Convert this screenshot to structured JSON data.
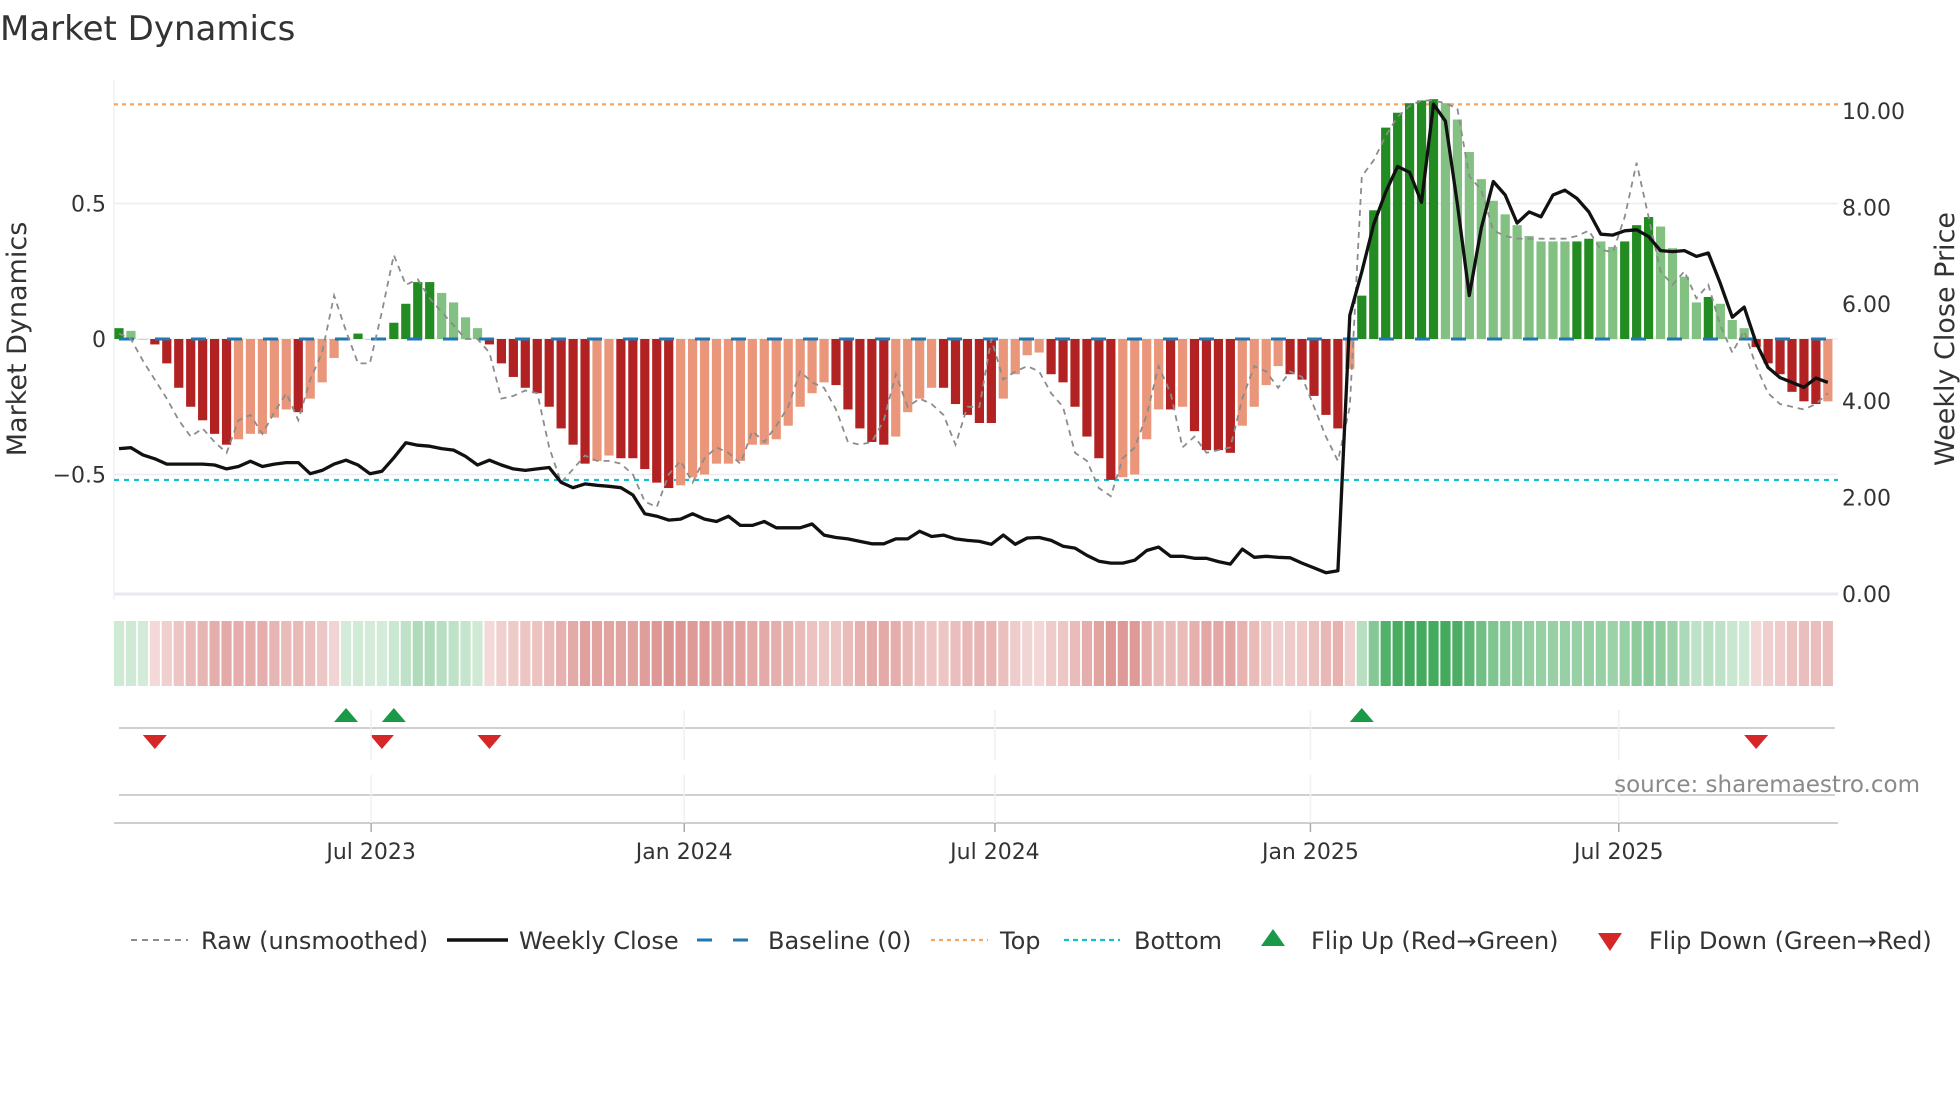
{
  "chart_data": {
    "type": "bar",
    "title": "Market Dynamics",
    "ylabel": "Market Dynamics",
    "ylabel_right": "Weekly Close Price",
    "ylim": [
      -0.92,
      0.95
    ],
    "ylim_right": [
      0,
      10.6
    ],
    "yticks": [
      {
        "value": 0.5,
        "label": "0.5"
      },
      {
        "value": 0,
        "label": "0"
      },
      {
        "value": -0.5,
        "label": "−0.5"
      }
    ],
    "yticks_right": [
      {
        "value": 10,
        "label": "10.00"
      },
      {
        "value": 8,
        "label": "8.00"
      },
      {
        "value": 6,
        "label": "6.00"
      },
      {
        "value": 4,
        "label": "4.00"
      },
      {
        "value": 2,
        "label": "2.00"
      },
      {
        "value": 0,
        "label": "0.00"
      }
    ],
    "xticks": [
      {
        "week": 21.1,
        "label": "Jul 2023"
      },
      {
        "week": 47.3,
        "label": "Jan 2024"
      },
      {
        "week": 73.3,
        "label": "Jul 2024"
      },
      {
        "week": 99.7,
        "label": "Jan 2025"
      },
      {
        "week": 125.5,
        "label": "Jul 2025"
      }
    ],
    "top_level": 0.866,
    "bottom_level": -0.52,
    "baseline": 0,
    "colors": {
      "pos_strong": "#228b22",
      "pos_weak": "#82c182",
      "neg_strong": "#b22222",
      "neg_weak": "#e9967a",
      "close": "#111111",
      "raw": "#8c8c8c",
      "baseline": "#1f77b4",
      "top": "#f4a460",
      "bottom": "#17becf",
      "flip_up": "#1a9a48",
      "flip_down": "#d62728"
    },
    "bars": [
      0.04,
      0.03,
      0,
      -0.02,
      -0.09,
      -0.18,
      -0.25,
      -0.3,
      -0.35,
      -0.39,
      -0.37,
      -0.35,
      -0.35,
      -0.29,
      -0.26,
      -0.27,
      -0.22,
      -0.16,
      -0.07,
      0,
      0.02,
      0,
      0,
      0.06,
      0.13,
      0.21,
      0.21,
      0.17,
      0.135,
      0.08,
      0.04,
      -0.02,
      -0.09,
      -0.14,
      -0.18,
      -0.2,
      -0.25,
      -0.33,
      -0.39,
      -0.46,
      -0.45,
      -0.43,
      -0.44,
      -0.44,
      -0.48,
      -0.53,
      -0.55,
      -0.54,
      -0.51,
      -0.5,
      -0.46,
      -0.46,
      -0.45,
      -0.39,
      -0.39,
      -0.37,
      -0.32,
      -0.25,
      -0.2,
      -0.16,
      -0.17,
      -0.26,
      -0.33,
      -0.38,
      -0.39,
      -0.36,
      -0.27,
      -0.22,
      -0.18,
      -0.18,
      -0.24,
      -0.28,
      -0.31,
      -0.31,
      -0.22,
      -0.13,
      -0.06,
      -0.05,
      -0.13,
      -0.16,
      -0.25,
      -0.36,
      -0.44,
      -0.52,
      -0.51,
      -0.5,
      -0.37,
      -0.26,
      -0.26,
      -0.25,
      -0.34,
      -0.41,
      -0.41,
      -0.42,
      -0.32,
      -0.25,
      -0.17,
      -0.1,
      -0.13,
      -0.15,
      -0.21,
      -0.28,
      -0.33,
      -0.11,
      0.16,
      0.475,
      0.78,
      0.835,
      0.87,
      0.88,
      0.885,
      0.87,
      0.81,
      0.69,
      0.59,
      0.51,
      0.46,
      0.42,
      0.38,
      0.36,
      0.36,
      0.36,
      0.36,
      0.37,
      0.36,
      0.34,
      0.36,
      0.42,
      0.45,
      0.415,
      0.335,
      0.23,
      0.135,
      0.155,
      0.13,
      0.07,
      0.04,
      -0.03,
      -0.09,
      -0.13,
      -0.195,
      -0.23,
      -0.24,
      -0.23
    ],
    "shade": [
      "D",
      "L",
      "L",
      "D",
      "D",
      "D",
      "D",
      "D",
      "D",
      "D",
      "L",
      "L",
      "L",
      "L",
      "L",
      "D",
      "L",
      "L",
      "L",
      "L",
      "D",
      "L",
      "L",
      "D",
      "D",
      "D",
      "D",
      "L",
      "L",
      "L",
      "L",
      "D",
      "D",
      "D",
      "D",
      "D",
      "D",
      "D",
      "D",
      "D",
      "L",
      "L",
      "D",
      "D",
      "D",
      "D",
      "D",
      "L",
      "L",
      "L",
      "L",
      "L",
      "L",
      "L",
      "L",
      "L",
      "L",
      "L",
      "L",
      "L",
      "D",
      "D",
      "D",
      "D",
      "D",
      "L",
      "L",
      "L",
      "L",
      "D",
      "D",
      "D",
      "D",
      "D",
      "L",
      "L",
      "L",
      "L",
      "D",
      "D",
      "D",
      "D",
      "D",
      "D",
      "L",
      "L",
      "L",
      "L",
      "D",
      "L",
      "D",
      "D",
      "D",
      "D",
      "L",
      "L",
      "L",
      "L",
      "D",
      "D",
      "D",
      "D",
      "D",
      "L",
      "D",
      "D",
      "D",
      "D",
      "D",
      "D",
      "D",
      "L",
      "L",
      "L",
      "L",
      "L",
      "L",
      "L",
      "L",
      "L",
      "L",
      "L",
      "D",
      "D",
      "L",
      "L",
      "D",
      "D",
      "D",
      "L",
      "L",
      "L",
      "L",
      "D",
      "L",
      "L",
      "L",
      "D",
      "D",
      "D",
      "D",
      "D",
      "D",
      "L"
    ],
    "raw": [
      0.02,
      0.0,
      -0.08,
      -0.15,
      -0.22,
      -0.3,
      -0.36,
      -0.33,
      -0.38,
      -0.42,
      -0.3,
      -0.28,
      -0.35,
      -0.27,
      -0.2,
      -0.3,
      -0.15,
      -0.05,
      0.16,
      0.03,
      -0.09,
      -0.09,
      0.1,
      0.31,
      0.2,
      0.22,
      0.15,
      0.1,
      0.05,
      0.0,
      0.0,
      -0.05,
      -0.22,
      -0.21,
      -0.19,
      -0.2,
      -0.4,
      -0.53,
      -0.48,
      -0.43,
      -0.45,
      -0.45,
      -0.46,
      -0.5,
      -0.6,
      -0.62,
      -0.5,
      -0.45,
      -0.53,
      -0.44,
      -0.4,
      -0.42,
      -0.46,
      -0.34,
      -0.38,
      -0.32,
      -0.25,
      -0.12,
      -0.16,
      -0.18,
      -0.26,
      -0.38,
      -0.39,
      -0.38,
      -0.3,
      -0.13,
      -0.25,
      -0.22,
      -0.24,
      -0.28,
      -0.39,
      -0.25,
      -0.25,
      0.0,
      -0.15,
      -0.12,
      -0.1,
      -0.12,
      -0.2,
      -0.25,
      -0.42,
      -0.45,
      -0.55,
      -0.58,
      -0.44,
      -0.4,
      -0.28,
      -0.1,
      -0.2,
      -0.4,
      -0.36,
      -0.42,
      -0.41,
      -0.4,
      -0.22,
      -0.1,
      -0.12,
      -0.18,
      -0.12,
      -0.14,
      -0.25,
      -0.36,
      -0.45,
      -0.25,
      0.6,
      0.66,
      0.75,
      0.82,
      0.86,
      0.88,
      0.88,
      0.87,
      0.85,
      0.6,
      0.55,
      0.4,
      0.38,
      0.37,
      0.37,
      0.37,
      0.37,
      0.37,
      0.38,
      0.4,
      0.33,
      0.32,
      0.45,
      0.65,
      0.45,
      0.25,
      0.2,
      0.25,
      0.15,
      0.2,
      0.05,
      -0.05,
      0.03,
      -0.1,
      -0.2,
      -0.24,
      -0.25,
      -0.26,
      -0.24,
      -0.2
    ],
    "close": [
      3.01,
      3.03,
      2.88,
      2.8,
      2.69,
      2.69,
      2.69,
      2.69,
      2.67,
      2.59,
      2.64,
      2.75,
      2.64,
      2.69,
      2.72,
      2.72,
      2.49,
      2.56,
      2.69,
      2.77,
      2.67,
      2.49,
      2.54,
      2.82,
      3.13,
      3.08,
      3.06,
      3.01,
      2.98,
      2.85,
      2.67,
      2.77,
      2.67,
      2.59,
      2.56,
      2.59,
      2.62,
      2.31,
      2.2,
      2.28,
      2.25,
      2.23,
      2.2,
      2.05,
      1.66,
      1.61,
      1.53,
      1.55,
      1.66,
      1.55,
      1.5,
      1.61,
      1.42,
      1.42,
      1.5,
      1.37,
      1.37,
      1.37,
      1.45,
      1.22,
      1.17,
      1.14,
      1.09,
      1.04,
      1.04,
      1.14,
      1.14,
      1.3,
      1.19,
      1.22,
      1.14,
      1.11,
      1.09,
      1.03,
      1.22,
      1.03,
      1.16,
      1.17,
      1.11,
      0.99,
      0.95,
      0.8,
      0.68,
      0.64,
      0.64,
      0.7,
      0.9,
      0.97,
      0.78,
      0.78,
      0.74,
      0.74,
      0.67,
      0.62,
      0.93,
      0.76,
      0.78,
      0.76,
      0.75,
      0.64,
      0.54,
      0.44,
      0.48,
      5.77,
      6.67,
      7.66,
      8.32,
      8.85,
      8.73,
      8.11,
      10.14,
      9.79,
      8.07,
      6.18,
      7.58,
      8.54,
      8.26,
      7.68,
      7.91,
      7.81,
      8.26,
      8.36,
      8.19,
      7.91,
      7.45,
      7.43,
      7.52,
      7.54,
      7.4,
      7.11,
      7.09,
      7.11,
      6.99,
      7.06,
      6.43,
      5.73,
      5.94,
      5.2,
      4.69,
      4.48,
      4.38,
      4.28,
      4.47,
      4.38
    ],
    "flips_up": [
      19,
      23,
      104
    ],
    "flips_down": [
      3,
      22,
      31,
      137
    ],
    "legend": {
      "placement": "bottom",
      "raw": "Raw (unsmoothed)",
      "close": "Weekly Close",
      "baseline": "Baseline (0)",
      "top": "Top",
      "bottom": "Bottom",
      "flip_up": "Flip Up (Red→Green)",
      "flip_down": "Flip Down (Green→Red)"
    },
    "source": "source: sharemaestro.com"
  }
}
